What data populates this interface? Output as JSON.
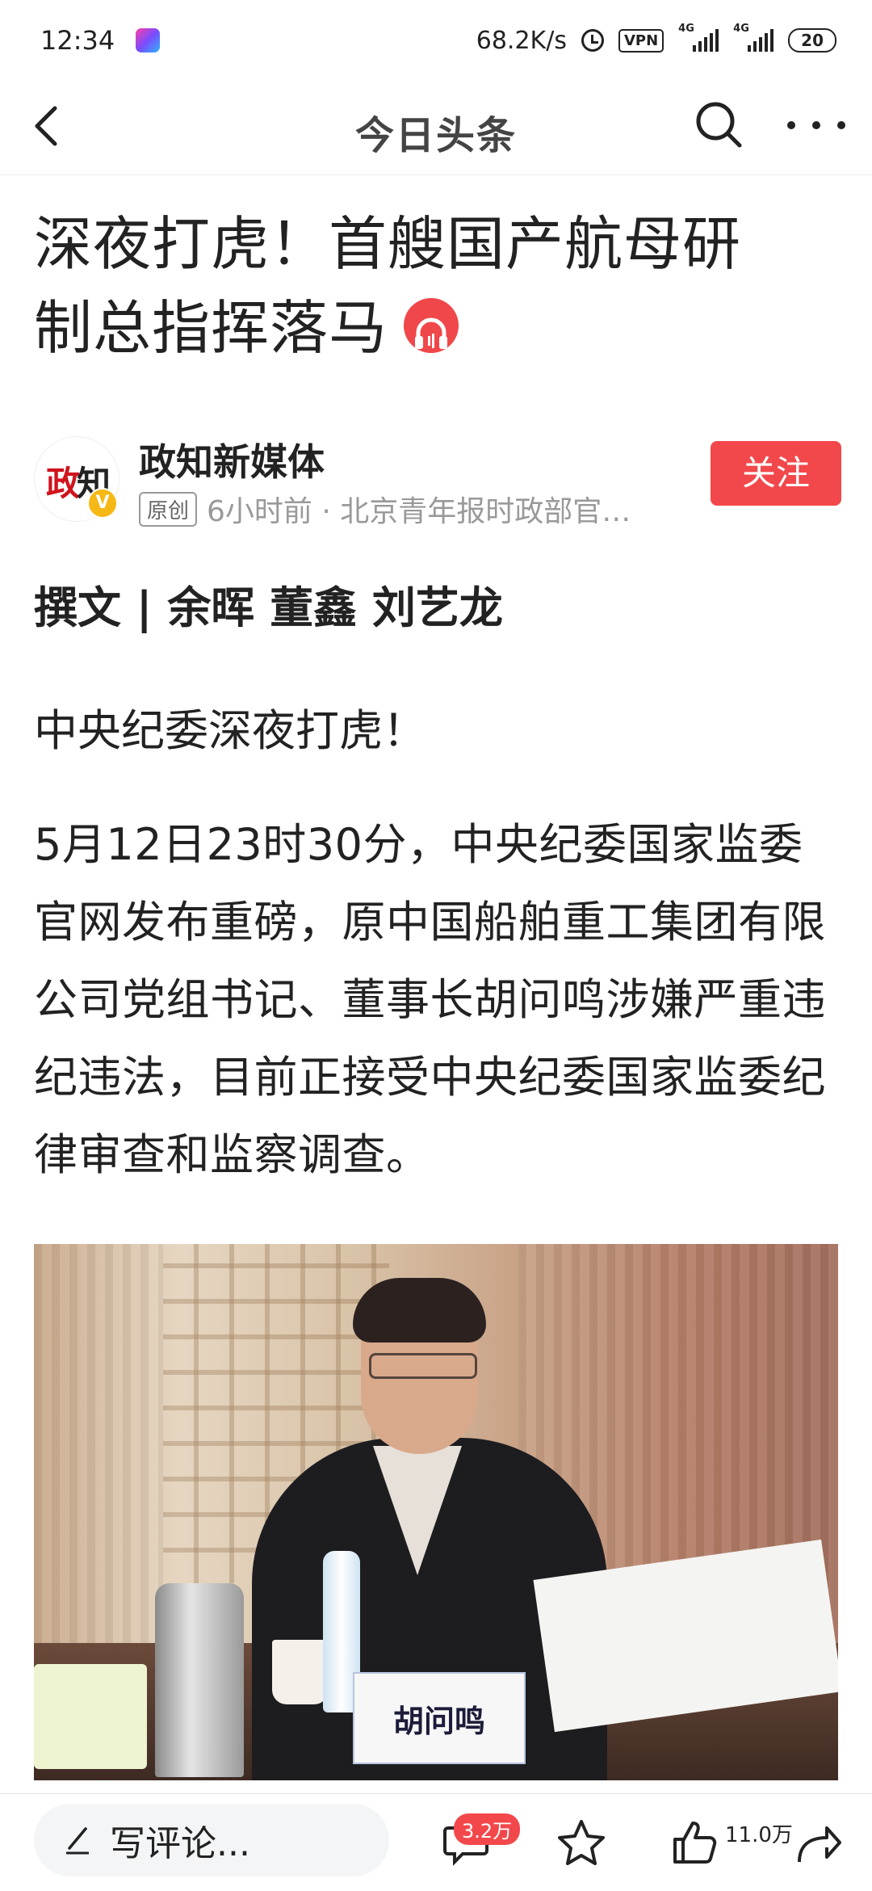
{
  "status_bar": {
    "time": "12:34",
    "network_speed": "68.2K/s",
    "vpn": "VPN",
    "signal1": "4G",
    "signal2": "4G",
    "battery": "20"
  },
  "nav": {
    "title": "今日头条"
  },
  "article": {
    "headline_line1": "深夜打虎！首艘国产航母研",
    "headline_line2": "制总指挥落马",
    "author": {
      "name": "政知新媒体",
      "avatar_text_a": "政",
      "avatar_text_b": "知",
      "verified": "V",
      "original_badge": "原创",
      "meta": "6小时前 · 北京青年报时政部官…",
      "follow_label": "关注"
    },
    "byline": "撰文 | 余晖 董鑫 刘艺龙",
    "para1": "中央纪委深夜打虎！",
    "para2": "5月12日23时30分，中央纪委国家监委官网发布重磅，原中国船舶重工集团有限公司党组书记、董事长胡问鸣涉嫌严重违纪违法，目前正接受中央纪委国家监委纪律审查和监察调查。",
    "photo": {
      "nameplate": "胡问鸣"
    }
  },
  "bottom_bar": {
    "comment_placeholder": "写评论...",
    "comment_count": "3.2万",
    "like_count": "11.0万"
  }
}
